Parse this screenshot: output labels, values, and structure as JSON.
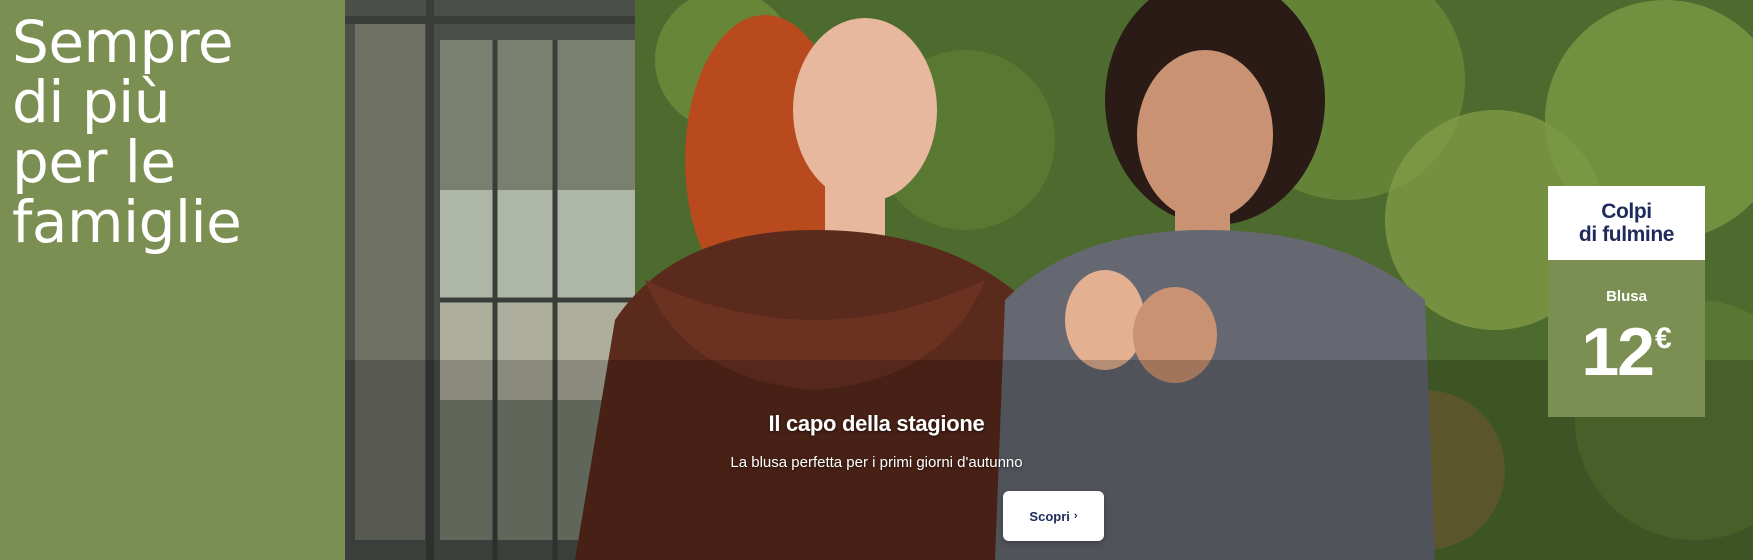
{
  "headline": {
    "lines": [
      "Sempre",
      "di più",
      "per le",
      "famiglie"
    ]
  },
  "promo": {
    "title": "Il capo della stagione",
    "subtitle": "La blusa perfetta per i primi giorni d'autunno",
    "cta_label": "Scopri",
    "cta_icon": "chevron-right-icon"
  },
  "badge": {
    "line1": "Colpi",
    "line2": "di fulmine",
    "product": "Blusa",
    "price": "12",
    "currency": "€"
  },
  "colors": {
    "olive": "#7b8f53",
    "navy_text": "#1f2b5a",
    "white": "#ffffff"
  }
}
